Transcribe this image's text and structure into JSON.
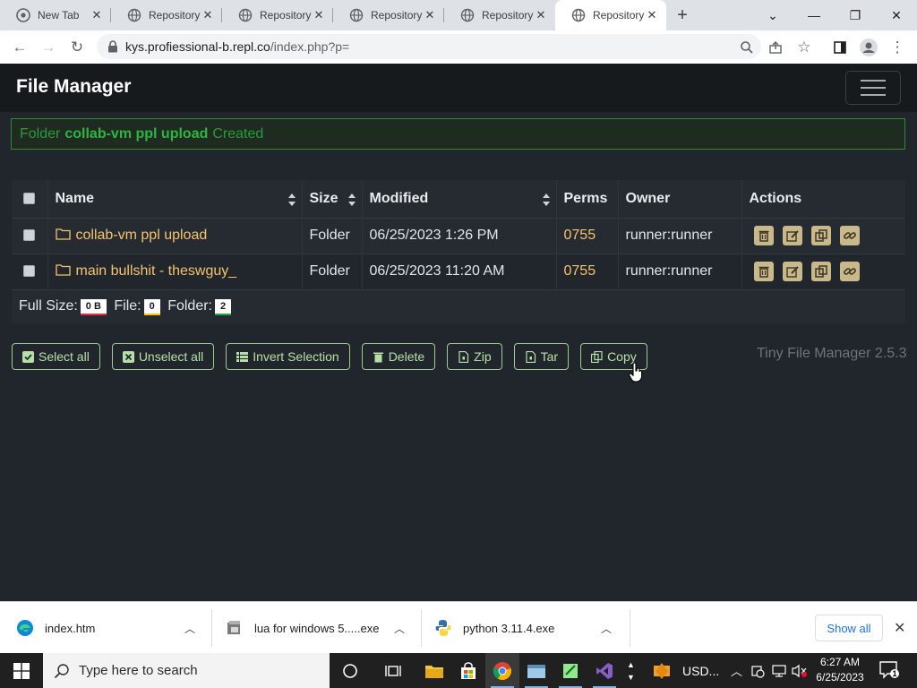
{
  "browser": {
    "tabs": [
      {
        "title": "New Tab",
        "active": false
      },
      {
        "title": "Repository",
        "active": false
      },
      {
        "title": "Repository",
        "active": false
      },
      {
        "title": "Repository",
        "active": false
      },
      {
        "title": "Repository",
        "active": false
      },
      {
        "title": "Repository",
        "active": true
      }
    ],
    "url_domain": "kys.profiessional-b.repl.co",
    "url_path": "/index.php?p="
  },
  "page": {
    "brand": "File Manager",
    "alert": {
      "prefix": "Folder",
      "name": "collab-vm ppl upload",
      "suffix": "Created"
    },
    "table": {
      "columns": [
        "Name",
        "Size",
        "Modified",
        "Perms",
        "Owner",
        "Actions"
      ],
      "rows": [
        {
          "name": "collab-vm ppl upload",
          "size": "Folder",
          "modified": "06/25/2023 1:26 PM",
          "perms": "0755",
          "owner": "runner:runner"
        },
        {
          "name": "main bullshit - theswguy_",
          "size": "Folder",
          "modified": "06/25/2023 11:20 AM",
          "perms": "0755",
          "owner": "runner:runner"
        }
      ],
      "footer": {
        "full_size_label": "Full Size:",
        "full_size_value": "0 B",
        "file_label": "File:",
        "file_value": "0",
        "folder_label": "Folder:",
        "folder_value": "2"
      }
    },
    "buttons": {
      "select_all": "Select all",
      "unselect_all": "Unselect all",
      "invert_selection": "Invert Selection",
      "delete": "Delete",
      "zip": "Zip",
      "tar": "Tar",
      "copy": "Copy"
    },
    "version": "Tiny File Manager 2.5.3"
  },
  "downloads": {
    "items": [
      "index.htm",
      "lua for windows 5.....exe",
      "python 3.11.4.exe"
    ],
    "show_all": "Show all"
  },
  "taskbar": {
    "search_placeholder": "Type here to search",
    "currency": "USD...",
    "time": "6:27 AM",
    "date": "6/25/2023",
    "notification_count": "1"
  },
  "colors": {
    "accent_green": "#2fb443",
    "folder_yellow": "#f5c36b",
    "outline_green": "#9fcc8f"
  }
}
